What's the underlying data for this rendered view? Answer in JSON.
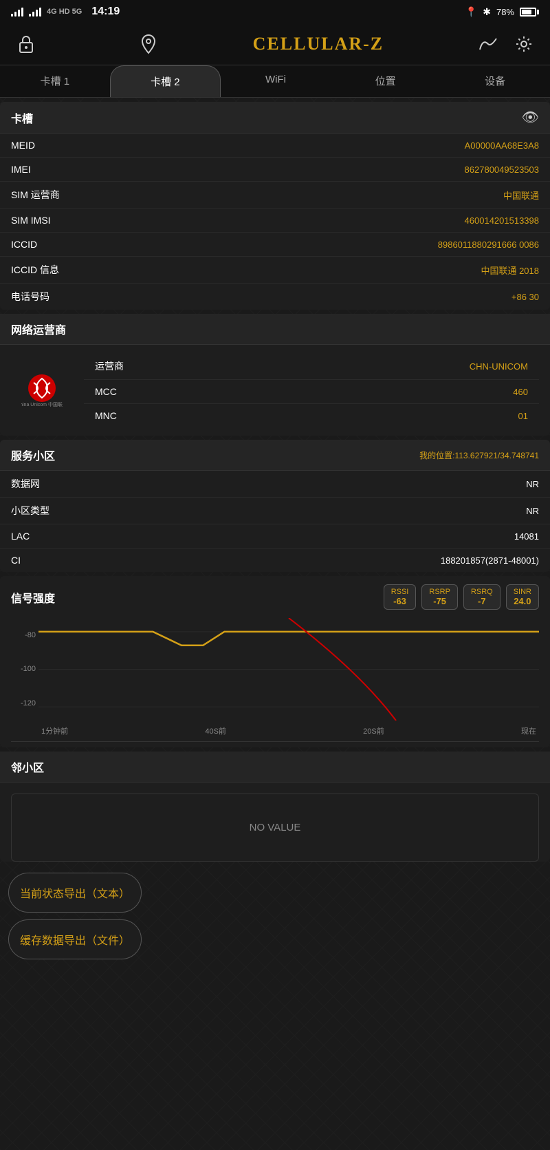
{
  "statusBar": {
    "network": "4G HD 5G",
    "time": "14:19",
    "location_icon": "📍",
    "bluetooth": "⚡",
    "battery_percent": "78%"
  },
  "header": {
    "lock_icon": "🔓",
    "map_icon": "📍",
    "title": "Cellular-Z",
    "signal_icon": "∧∨",
    "settings_icon": "⚙"
  },
  "tabs": [
    {
      "id": "slot1",
      "label": "卡槽 1",
      "active": false
    },
    {
      "id": "slot2",
      "label": "卡槽 2",
      "active": true
    },
    {
      "id": "wifi",
      "label": "WiFi",
      "active": false
    },
    {
      "id": "location",
      "label": "位置",
      "active": false
    },
    {
      "id": "device",
      "label": "设备",
      "active": false
    }
  ],
  "simSection": {
    "title": "卡槽",
    "eye_icon": "👁",
    "rows": [
      {
        "label": "MEID",
        "value": "A00000AA68E3A8"
      },
      {
        "label": "IMEI",
        "value": "862780049523503"
      },
      {
        "label": "SIM 运营商",
        "value": "中国联通"
      },
      {
        "label": "SIM IMSI",
        "value": "460014201513398"
      },
      {
        "label": "ICCID",
        "value": "8986011880291666 0086"
      },
      {
        "label": "ICCID 信息",
        "value": "中国联通 2018"
      },
      {
        "label": "电话号码",
        "value": "+86              30"
      }
    ]
  },
  "networkSection": {
    "title": "网络运营商",
    "operator_name": "中国联通",
    "operator_sub": "China\nunicom中国联通",
    "rows": [
      {
        "label": "运营商",
        "value": "CHN-UNICOM"
      },
      {
        "label": "MCC",
        "value": "460"
      },
      {
        "label": "MNC",
        "value": "01"
      }
    ]
  },
  "serviceCellSection": {
    "title": "服务小区",
    "location": "我的位置:113.627921/34.748741",
    "rows": [
      {
        "label": "数据网",
        "value": "NR"
      },
      {
        "label": "小区类型",
        "value": "NR"
      },
      {
        "label": "LAC",
        "value": "14081"
      },
      {
        "label": "CI",
        "value": "188201857(2871-48001)"
      }
    ]
  },
  "signalSection": {
    "title": "信号强度",
    "badges": [
      {
        "label": "RSSI",
        "value": "-63"
      },
      {
        "label": "RSRP",
        "value": "-75"
      },
      {
        "label": "RSRQ",
        "value": "-7"
      },
      {
        "label": "SINR",
        "value": "24.0"
      }
    ],
    "chart": {
      "y_labels": [
        "-80",
        "-100",
        "-120"
      ],
      "x_labels": [
        "1分钟前",
        "40S前",
        "20S前",
        "现在"
      ]
    }
  },
  "neighborSection": {
    "title": "邻小区",
    "no_value": "NO VALUE"
  },
  "buttons": [
    {
      "id": "export-text",
      "label": "当前状态导出（文本）"
    },
    {
      "id": "export-file",
      "label": "缓存数据导出（文件）"
    }
  ]
}
